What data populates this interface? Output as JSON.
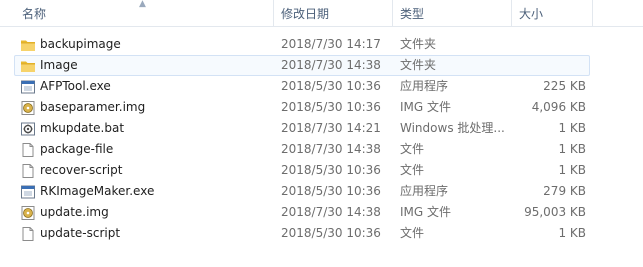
{
  "columns": {
    "name": "名称",
    "date": "修改日期",
    "type": "类型",
    "size": "大小"
  },
  "files": [
    {
      "name": "backupimage",
      "date": "2018/7/30 14:17",
      "type": "文件夹",
      "size": "",
      "icon": "folder-icon"
    },
    {
      "name": "Image",
      "date": "2018/7/30 14:38",
      "type": "文件夹",
      "size": "",
      "icon": "folder-icon",
      "selected": true
    },
    {
      "name": "AFPTool.exe",
      "date": "2018/5/30 10:36",
      "type": "应用程序",
      "size": "225 KB",
      "icon": "app-icon"
    },
    {
      "name": "baseparamer.img",
      "date": "2018/5/30 10:36",
      "type": "IMG 文件",
      "size": "4,096 KB",
      "icon": "disc-image-icon"
    },
    {
      "name": "mkupdate.bat",
      "date": "2018/7/30 14:21",
      "type": "Windows 批处理...",
      "size": "1 KB",
      "icon": "batch-file-icon"
    },
    {
      "name": "package-file",
      "date": "2018/7/30 14:38",
      "type": "文件",
      "size": "1 KB",
      "icon": "file-icon"
    },
    {
      "name": "recover-script",
      "date": "2018/5/30 10:36",
      "type": "文件",
      "size": "1 KB",
      "icon": "file-icon"
    },
    {
      "name": "RKImageMaker.exe",
      "date": "2018/5/30 10:36",
      "type": "应用程序",
      "size": "279 KB",
      "icon": "app-icon"
    },
    {
      "name": "update.img",
      "date": "2018/7/30 14:38",
      "type": "IMG 文件",
      "size": "95,003 KB",
      "icon": "disc-image-icon"
    },
    {
      "name": "update-script",
      "date": "2018/5/30 10:36",
      "type": "文件",
      "size": "1 KB",
      "icon": "file-icon"
    }
  ]
}
